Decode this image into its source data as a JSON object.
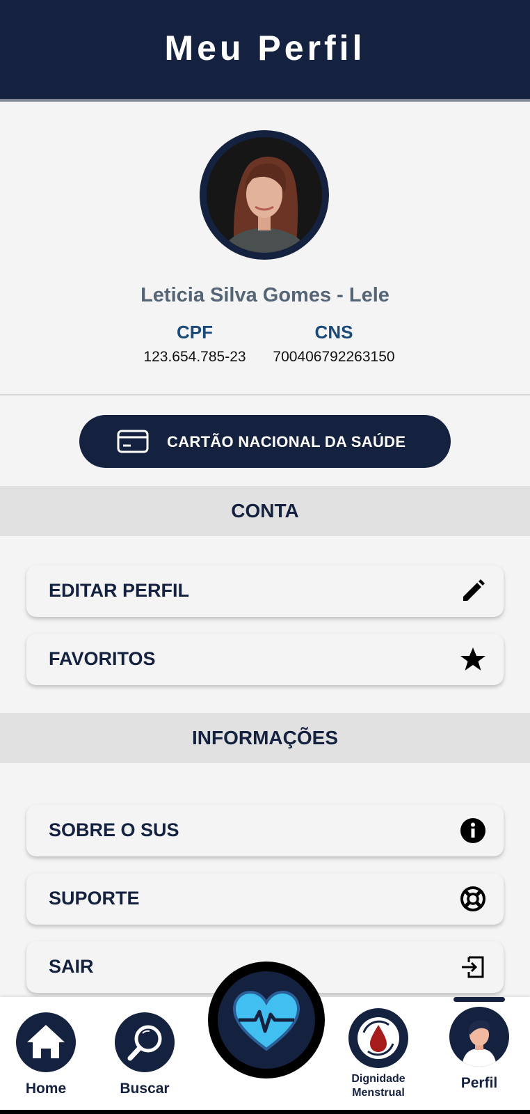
{
  "header": {
    "title": "Meu Perfil"
  },
  "profile": {
    "name": "Leticia Silva Gomes - Lele",
    "cpf_label": "CPF",
    "cpf_value": "123.654.785-23",
    "cns_label": "CNS",
    "cns_value": "700406792263150"
  },
  "card_button": {
    "label": "CARTÃO NACIONAL DA SAÚDE",
    "icon": "credit-card-icon"
  },
  "sections": {
    "account": {
      "title": "CONTA",
      "items": [
        {
          "label": "EDITAR PERFIL",
          "icon": "pencil-icon"
        },
        {
          "label": "FAVORITOS",
          "icon": "star-icon"
        }
      ]
    },
    "info": {
      "title": "INFORMAÇÕES",
      "items": [
        {
          "label": "SOBRE O SUS",
          "icon": "info-icon"
        },
        {
          "label": "SUPORTE",
          "icon": "lifebuoy-icon"
        },
        {
          "label": "SAIR",
          "icon": "logout-icon"
        }
      ]
    }
  },
  "bottom_nav": {
    "items": [
      {
        "label": "Home",
        "icon": "home-icon"
      },
      {
        "label": "Buscar",
        "icon": "search-icon"
      },
      {
        "label": "",
        "icon": "heart-pulse-icon"
      },
      {
        "label_line1": "Dignidade",
        "label_line2": "Menstrual",
        "icon": "blood-drop-icon"
      },
      {
        "label": "Perfil",
        "icon": "user-avatar-icon"
      }
    ],
    "active": "Perfil"
  },
  "colors": {
    "primary": "#15223f",
    "section_bg": "#e1e1e1",
    "page_bg": "#f4f4f4",
    "accent_blue": "#41bff0",
    "drop_red": "#a61c1c"
  }
}
